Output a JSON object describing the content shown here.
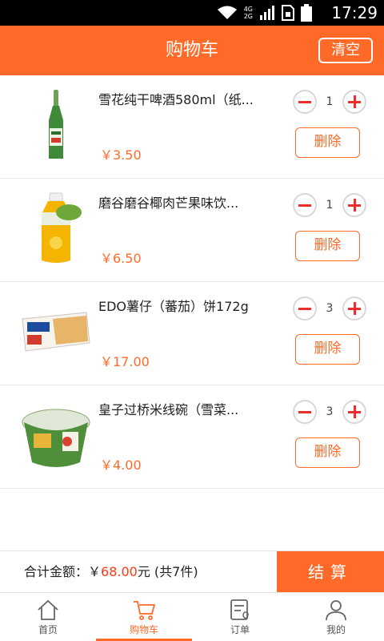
{
  "status_bar": {
    "time": "17:29",
    "net_top": "4G",
    "net_bottom": "2G"
  },
  "header": {
    "title": "购物车",
    "clear_label": "清空"
  },
  "cart": {
    "items": [
      {
        "name": "雪花纯干啤酒580ml（纸...",
        "price": "￥3.50",
        "qty": "1",
        "delete_label": "删除"
      },
      {
        "name": "磨谷磨谷椰肉芒果味饮...",
        "price": "￥6.50",
        "qty": "1",
        "delete_label": "删除"
      },
      {
        "name": "EDO薯仔（蕃茄）饼172g",
        "price": "￥17.00",
        "qty": "3",
        "delete_label": "删除"
      },
      {
        "name": "皇子过桥米线碗（雪菜...",
        "price": "￥4.00",
        "qty": "3",
        "delete_label": "删除"
      }
    ]
  },
  "checkout": {
    "total_label": "合计金额：￥",
    "total_amount": "68.00",
    "total_suffix": "元 (共7件)",
    "pay_label": "结算"
  },
  "tabs": [
    {
      "label": "首页",
      "icon": "home-icon",
      "active": false
    },
    {
      "label": "购物车",
      "icon": "cart-icon",
      "active": true
    },
    {
      "label": "订单",
      "icon": "order-icon",
      "active": false
    },
    {
      "label": "我的",
      "icon": "user-icon",
      "active": false
    }
  ],
  "colors": {
    "accent": "#ff6a28",
    "price_red": "#ff3a14",
    "plus_minus": "#ee2d2d"
  }
}
